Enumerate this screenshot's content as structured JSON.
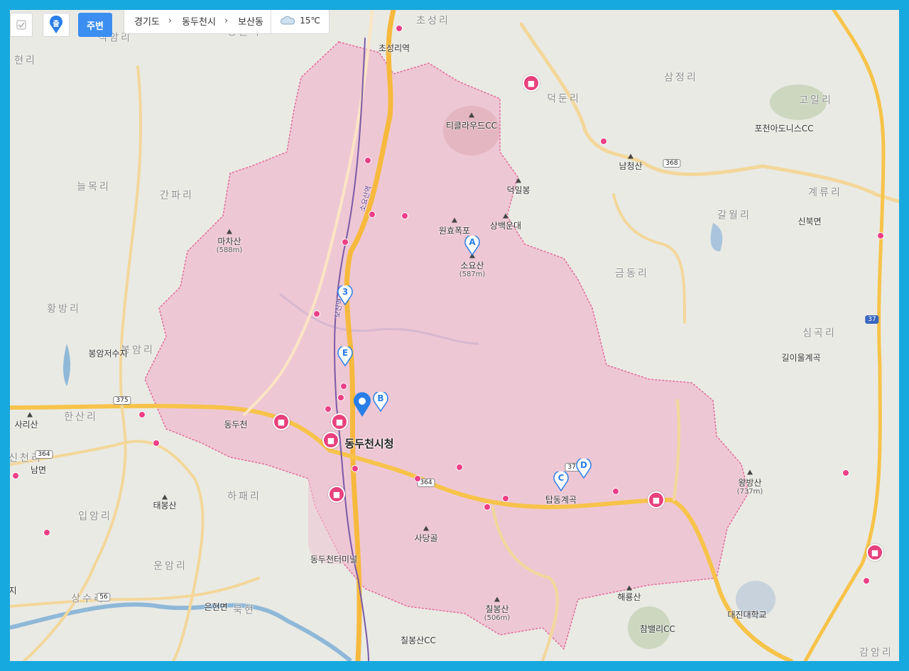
{
  "toolbar": {
    "checkbox_label": "",
    "start_marker_label": "출",
    "nearby_label": "주변"
  },
  "breadcrumb": {
    "province": "경기도",
    "city": "동두천시",
    "district": "보산동",
    "temperature": "15℃",
    "weather_icon": "cloud-icon"
  },
  "area_labels": [
    "초성리",
    "적암리",
    "양원리",
    "현리",
    "늘목리",
    "간파리",
    "황방리",
    "봉암리",
    "한산리",
    "사리산",
    "남면",
    "하패리",
    "입암리",
    "운암리",
    "상수리",
    "은현면",
    "삼정리",
    "덕둔리",
    "고일리",
    "계류리",
    "갈월리",
    "금동리",
    "신북면",
    "심곡리",
    "감암리",
    "신천리",
    "지",
    "묵현"
  ],
  "place_labels": {
    "choseong_station": "초성리역",
    "tickle_cc": "티클라우드CC",
    "deogilbong": "덕일봉",
    "wonhyo": "원효폭포",
    "sangbaek": "상백운대",
    "soyosan": "소요산",
    "soyosan_elev": "(587m)",
    "machasan": "마차산",
    "machasan_elev": "(588m)",
    "bongam_res": "봉암저수지",
    "dongducheon_ic": "동두천",
    "city_hall": "동두천시청",
    "taebongsan": "태봉산",
    "sadanggol": "사당골",
    "terminal": "동두천터미널",
    "tapdong": "탑동계곡",
    "chilbongsan": "칠봉산",
    "chilbongsan_elev": "(506m)",
    "chilbong_cc": "칠봉산CC",
    "haeryongsan": "해룡산",
    "chambaelli_cc": "참밸리CC",
    "daejin_univ": "대진대학교",
    "wangbangsan": "왕방산",
    "wangbangsan_elev": "(737m)",
    "gilyul": "길이울계곡",
    "namcheongsan": "남청산",
    "pocheon_adonis": "포천아도니스CC",
    "soyo_line": "소요산역",
    "boshan_line": "보산역"
  },
  "route_shields": [
    "375",
    "364",
    "379",
    "368",
    "56",
    "37"
  ],
  "markers": [
    "A",
    "B",
    "C",
    "D",
    "E",
    "3"
  ],
  "colors": {
    "region_fill": "#f2a9c6",
    "region_border": "#e36a9b",
    "frame": "#16a9df",
    "poi": "#e8417d",
    "marker": "#2a7ee8",
    "road_major": "#f7c349",
    "road_minor": "#f3d79a",
    "water": "#8fb8d8"
  }
}
